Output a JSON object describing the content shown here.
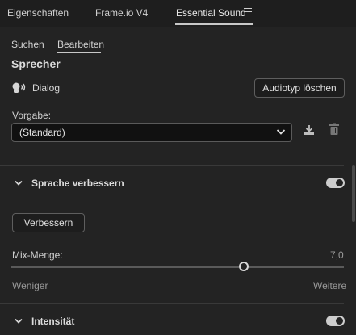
{
  "panel_tabs": [
    {
      "label": "Eigenschaften"
    },
    {
      "label": "Frame.io V4"
    },
    {
      "label": "Essential Sound"
    }
  ],
  "sub_tabs": [
    {
      "label": "Suchen"
    },
    {
      "label": "Bearbeiten"
    }
  ],
  "clip_type": {
    "title": "Sprecher",
    "type_label": "Dialog",
    "clear_button": "Audiotyp löschen"
  },
  "preset": {
    "label": "Vorgabe:",
    "value": "(Standard)"
  },
  "section_enhance": {
    "title": "Sprache verbessern",
    "enabled": true,
    "enhance_button": "Verbessern",
    "mix_label": "Mix-Menge:",
    "mix_value": "7,0",
    "mix_fraction": 0.7,
    "range_min": "Weniger",
    "range_max": "Weitere"
  },
  "section_intensity": {
    "title": "Intensität",
    "enabled": true
  },
  "colors": {
    "background": "#232323",
    "tab_bar": "#1e1e1e",
    "toggle_on": "#cdcdcd"
  }
}
